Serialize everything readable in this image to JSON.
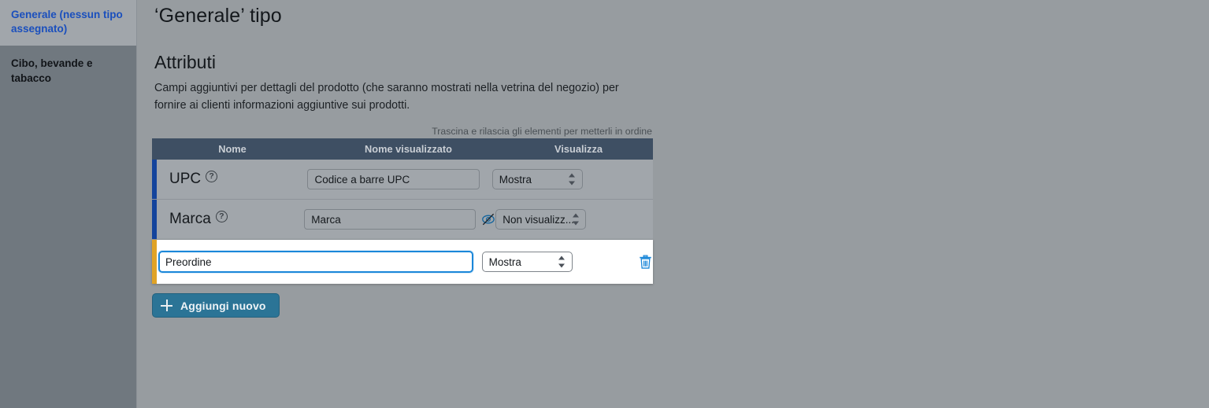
{
  "sidebar": {
    "items": [
      {
        "label": "Generale (nessun tipo assegnato)",
        "state": "active"
      },
      {
        "label": "Cibo, bevande e tabacco",
        "state": "default"
      }
    ]
  },
  "main": {
    "page_title": "‘Generale’ tipo",
    "section_title": "Attributi",
    "section_description": "Campi aggiuntivi per dettagli del prodotto (che saranno mostrati nella vetrina del negozio) per fornire ai clienti informazioni aggiuntive sui prodotti.",
    "drag_hint": "Trascina e rilascia gli elementi per metterli in ordine"
  },
  "table": {
    "headers": {
      "name": "Nome",
      "display_name": "Nome visualizzato",
      "visualize": "Visualizza"
    },
    "rows": [
      {
        "name": "UPC",
        "help_icon": "help-circle-icon",
        "display_name_value": "Codice a barre UPC",
        "visualize_value": "Mostra",
        "accent_color": "#13439c",
        "hidden_icon": null,
        "delete_icon": null
      },
      {
        "name": "Marca",
        "help_icon": "help-circle-icon",
        "display_name_value": "Marca",
        "visualize_value": "Non visualizz...",
        "accent_color": "#13439c",
        "hidden_icon": "eye-off-icon",
        "delete_icon": null
      }
    ],
    "new_row": {
      "display_name_value": "Preordine",
      "display_name_placeholder": "",
      "visualize_value": "Mostra",
      "accent_color": "#e0a326",
      "delete_icon": "trash-icon",
      "focused": true
    }
  },
  "actions": {
    "add_new_label": "Aggiungi nuovo",
    "add_new_icon": "plus-icon"
  },
  "colors": {
    "page_background": "#979ca0",
    "sidebar_background": "#70787f",
    "sidebar_active_background": "#a1a6ab",
    "sidebar_active_text": "#1a4fbd",
    "table_header_background": "#3e4f63",
    "row_background": "#a1a6ab",
    "accent_blue": "#13439c",
    "accent_amber": "#e0a326",
    "focus_blue": "#1b87d9",
    "button_teal": "#2b7496"
  }
}
